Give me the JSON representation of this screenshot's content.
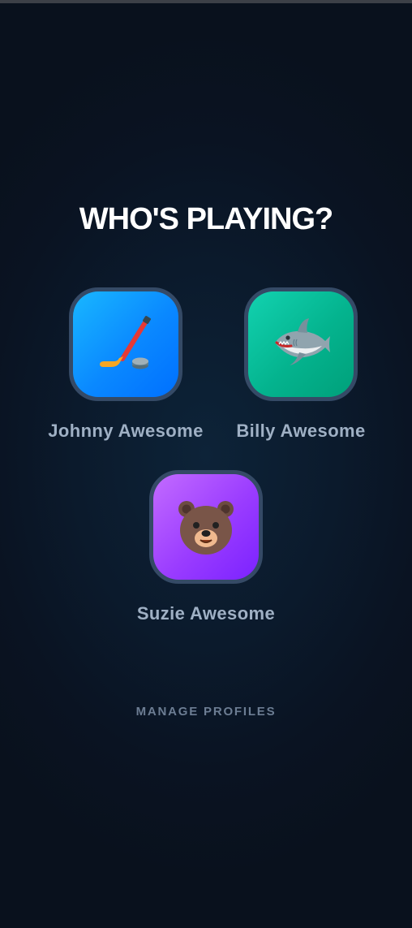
{
  "heading": "WHO'S PLAYING?",
  "profiles": [
    {
      "name": "Johnny Awesome",
      "icon": "hockey-stick-icon",
      "color": "#0a88ff"
    },
    {
      "name": "Billy Awesome",
      "icon": "shark-icon",
      "color": "#04b38e"
    },
    {
      "name": "Suzie Awesome",
      "icon": "bear-icon",
      "color": "#9a3cff"
    }
  ],
  "manage_label": "MANAGE PROFILES",
  "colors": {
    "background": "#0b1a2c",
    "avatar_border": "#354a66",
    "name_text": "#9fb0c4",
    "manage_text": "#6c7d93"
  }
}
